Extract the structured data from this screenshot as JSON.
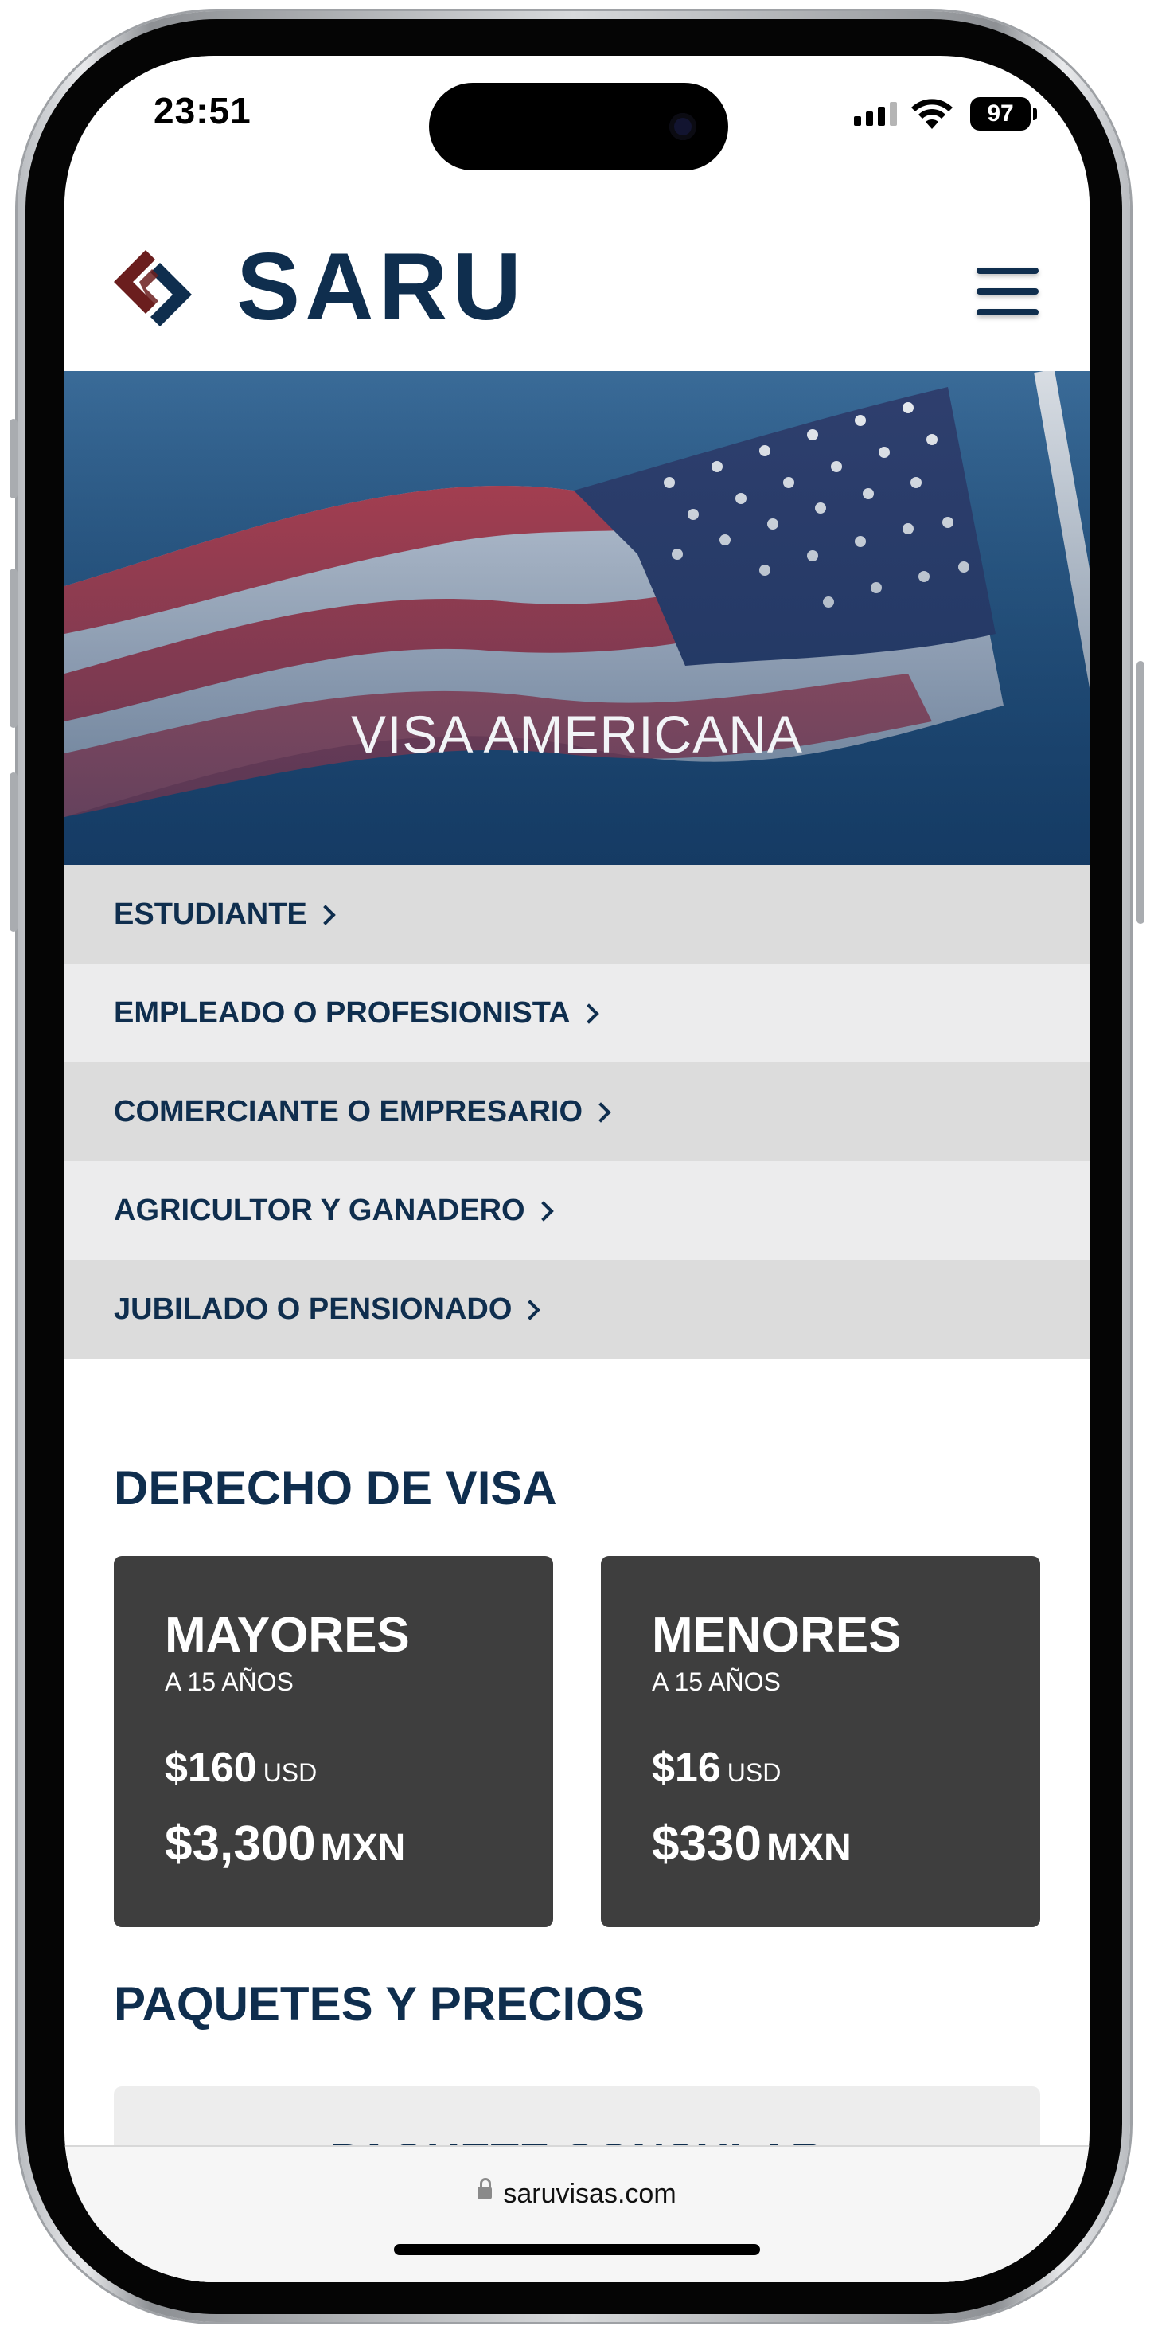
{
  "status_bar": {
    "time": "23:51",
    "battery": "97",
    "icons": [
      "signal-icon",
      "wifi-icon",
      "battery-icon"
    ]
  },
  "header": {
    "logo_text": "SARU",
    "menu_icon": "hamburger-menu-icon"
  },
  "hero": {
    "title": "VISA AMERICANA",
    "image": "american-flag"
  },
  "categories": [
    {
      "label": "ESTUDIANTE"
    },
    {
      "label": "EMPLEADO O PROFESIONISTA"
    },
    {
      "label": "COMERCIANTE O EMPRESARIO"
    },
    {
      "label": "AGRICULTOR Y GANADERO"
    },
    {
      "label": "JUBILADO O PENSIONADO"
    }
  ],
  "visa_fee": {
    "title": "DERECHO DE VISA",
    "cards": [
      {
        "title": "MAYORES",
        "subtitle": "A 15 AÑOS",
        "usd_amount": "$160",
        "usd_label": "USD",
        "mxn_amount": "$3,300",
        "mxn_label": "MXN"
      },
      {
        "title": "MENORES",
        "subtitle": "A 15 AÑOS",
        "usd_amount": "$16",
        "usd_label": "USD",
        "mxn_amount": "$330",
        "mxn_label": "MXN"
      }
    ]
  },
  "packages": {
    "title": "PAQUETES Y PRECIOS",
    "first_package": "PAQUETE CONSULAR"
  },
  "browser": {
    "url": "saruvisas.com"
  },
  "colors": {
    "brand_navy": "#0f2e4e",
    "brand_red": "#6b1e1e",
    "card_dark": "#3e3e3e",
    "list_odd": "#dcdcdc",
    "list_even": "#ececed"
  }
}
